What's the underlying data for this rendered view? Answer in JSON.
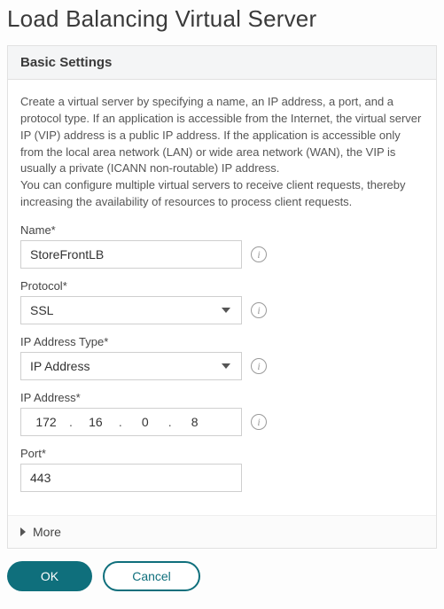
{
  "page_title": "Load Balancing Virtual Server",
  "panel_header": "Basic Settings",
  "description_1": "Create a virtual server by specifying a name, an IP address, a port, and a protocol type. If an application is accessible from the Internet, the virtual server IP (VIP) address is a public IP address. If the application is accessible only from the local area network (LAN) or wide area network (WAN), the VIP is usually a private (ICANN non-routable) IP address.",
  "description_2": "You can configure multiple virtual servers to receive client requests, thereby increasing the availability of resources to process client requests.",
  "fields": {
    "name": {
      "label": "Name*",
      "value": "StoreFrontLB"
    },
    "protocol": {
      "label": "Protocol*",
      "value": "SSL"
    },
    "ip_type": {
      "label": "IP Address Type*",
      "value": "IP Address"
    },
    "ip_address": {
      "label": "IP Address*",
      "oct1": "172",
      "oct2": "16",
      "oct3": "0",
      "oct4": "8"
    },
    "port": {
      "label": "Port*",
      "value": "443"
    }
  },
  "more_label": "More",
  "buttons": {
    "ok": "OK",
    "cancel": "Cancel"
  },
  "info_glyph": "i"
}
